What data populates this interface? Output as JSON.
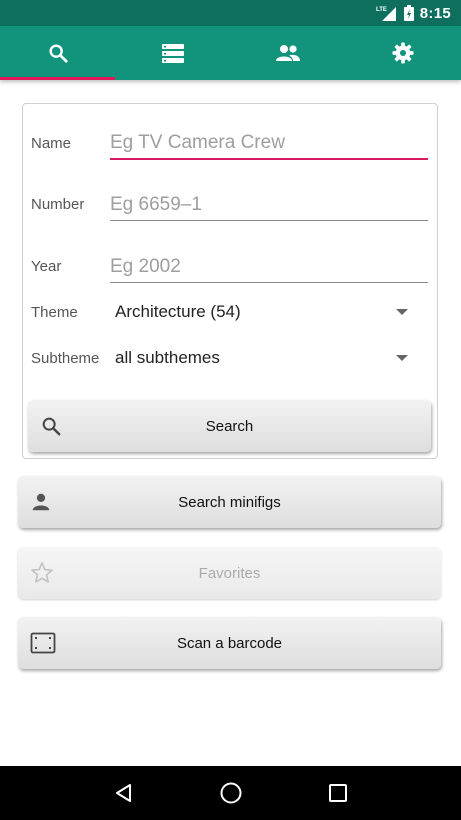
{
  "status_bar": {
    "network": "LTE",
    "time": "8:15"
  },
  "tabs": [
    {
      "icon": "search-icon",
      "selected": true
    },
    {
      "icon": "list-icon",
      "selected": false
    },
    {
      "icon": "people-icon",
      "selected": false
    },
    {
      "icon": "settings-icon",
      "selected": false
    }
  ],
  "colors": {
    "accent": "#e2195c",
    "primary": "#12937c",
    "primary_dark": "#0f6f5f"
  },
  "form": {
    "name": {
      "label": "Name",
      "placeholder": "Eg TV Camera Crew",
      "value": ""
    },
    "number": {
      "label": "Number",
      "placeholder": "Eg 6659–1",
      "value": ""
    },
    "year": {
      "label": "Year",
      "placeholder": "Eg 2002",
      "value": ""
    },
    "theme": {
      "label": "Theme",
      "selected": "Architecture (54)"
    },
    "subtheme": {
      "label": "Subtheme",
      "selected": "all subthemes"
    },
    "search_button": "Search"
  },
  "actions": {
    "minifigs": "Search minifigs",
    "favorites": "Favorites",
    "scan": "Scan a barcode"
  }
}
